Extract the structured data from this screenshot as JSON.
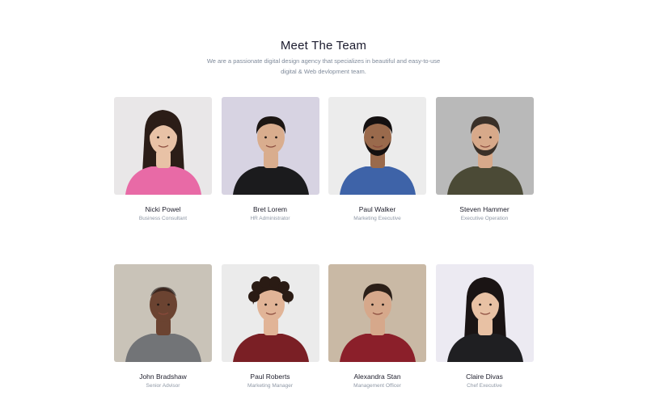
{
  "section": {
    "title": "Meet The Team",
    "subtitle": "We are a passionate digital design agency that specializes in beautiful and easy-to-use digital & Web devlopment team."
  },
  "members": [
    {
      "name": "Nicki Powel",
      "role": "Business Consultant",
      "bg": "#e9e7e8",
      "skin": "#e8c2a6",
      "hair": "#2b1d17",
      "shirt": "#e86aa6",
      "hair_style": "long"
    },
    {
      "name": "Bret Lorem",
      "role": "HR Administrator",
      "bg": "#d7d3e2",
      "skin": "#d9ad8e",
      "hair": "#1c1613",
      "shirt": "#1b1b1d",
      "hair_style": "short"
    },
    {
      "name": "Paul Walker",
      "role": "Marketing Executive",
      "bg": "#ececec",
      "skin": "#9a6a4c",
      "hair": "#141010",
      "shirt": "#3e63a8",
      "hair_style": "short-beard"
    },
    {
      "name": "Steven Hammer",
      "role": "Executive Operation",
      "bg": "#b9b9b9",
      "skin": "#d7a98a",
      "hair": "#3a3028",
      "shirt": "#4b4a36",
      "hair_style": "short-beard"
    },
    {
      "name": "John Bradshaw",
      "role": "Senior Advisor",
      "bg": "#c9c3b8",
      "skin": "#6b4331",
      "hair": "#1a1210",
      "shirt": "#727477",
      "hair_style": "bald"
    },
    {
      "name": "Paul Roberts",
      "role": "Marketing Manager",
      "bg": "#ebebeb",
      "skin": "#e1b497",
      "hair": "#2a1b14",
      "shirt": "#7a1f25",
      "hair_style": "curly"
    },
    {
      "name": "Alexandra Stan",
      "role": "Management Officer",
      "bg": "#c9b9a5",
      "skin": "#d6a88b",
      "hair": "#2b1f18",
      "shirt": "#8b1f2a",
      "hair_style": "short"
    },
    {
      "name": "Claire Divas",
      "role": "Chef Executive",
      "bg": "#eceaf2",
      "skin": "#e8c1a4",
      "hair": "#1a1414",
      "shirt": "#1f1f22",
      "hair_style": "long"
    }
  ]
}
